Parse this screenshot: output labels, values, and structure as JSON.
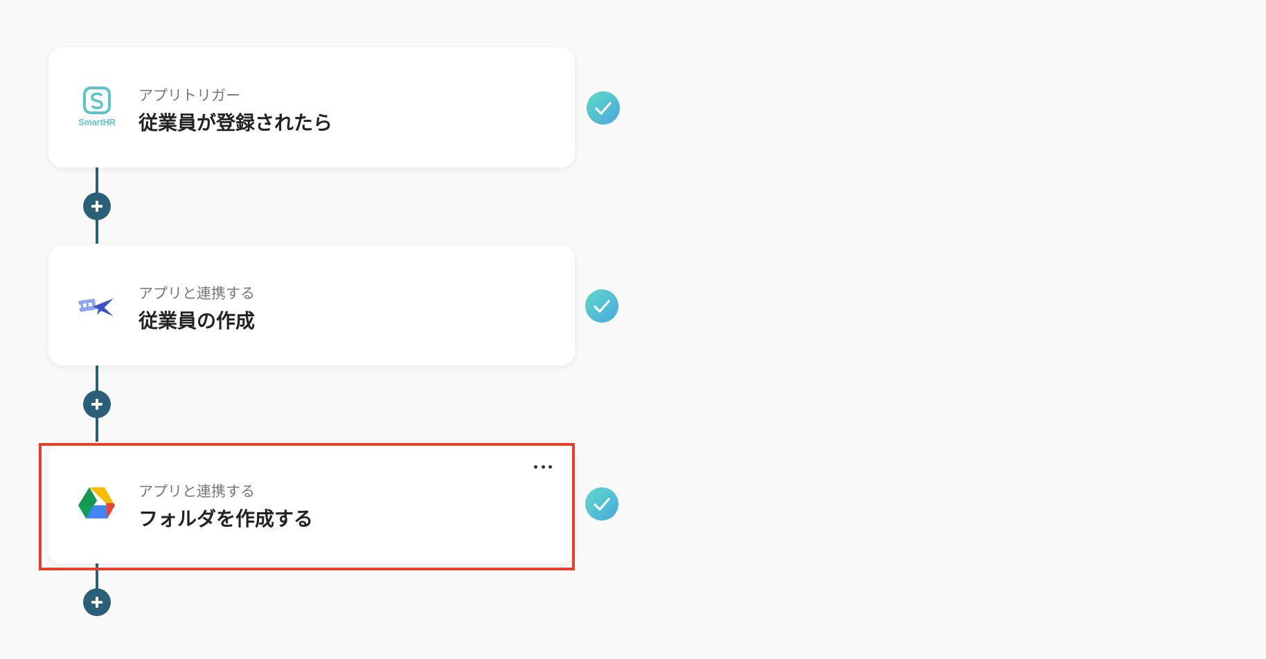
{
  "steps": [
    {
      "app_icon": "smarthr-logo",
      "app_label": "SmartHR",
      "subtitle": "アプリトリガー",
      "title": "従業員が登録されたら",
      "status": "completed"
    },
    {
      "app_icon": "ticket-plane-logo",
      "subtitle": "アプリと連携する",
      "title": "従業員の作成",
      "status": "completed"
    },
    {
      "app_icon": "google-drive-logo",
      "subtitle": "アプリと連携する",
      "title": "フォルダを作成する",
      "status": "completed",
      "highlighted": true
    }
  ],
  "colors": {
    "connector": "#2b5f78",
    "check_gradient_start": "#5fd9c8",
    "check_gradient_end": "#4aa8dd",
    "highlight_border": "#e33f2b",
    "smarthr_brand": "#5bc4c9"
  }
}
